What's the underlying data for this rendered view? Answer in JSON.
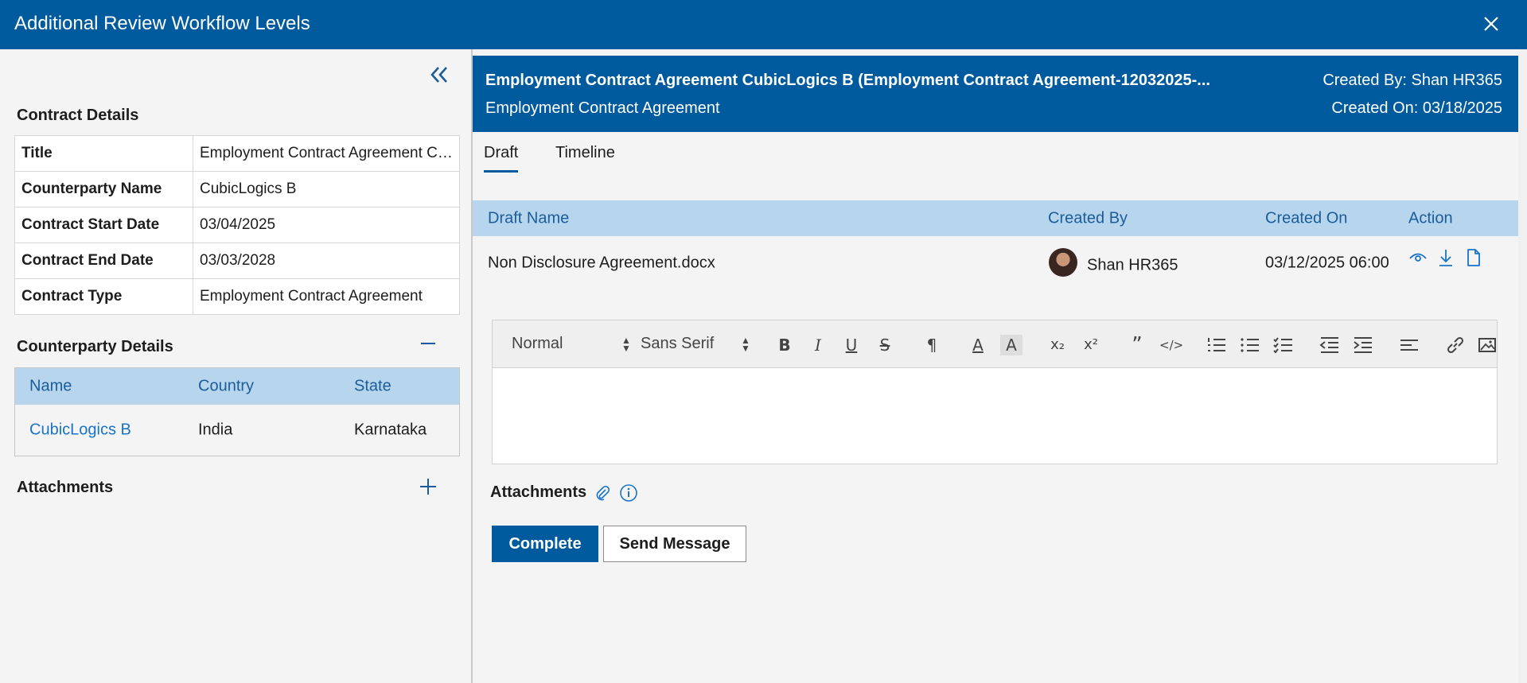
{
  "window": {
    "title": "Additional Review Workflow Levels"
  },
  "left": {
    "contract_details_title": "Contract Details",
    "details": [
      {
        "key": "Title",
        "value": "Employment Contract Agreement CubicLogics B"
      },
      {
        "key": "Counterparty Name",
        "value": "CubicLogics B"
      },
      {
        "key": "Contract Start Date",
        "value": "03/04/2025"
      },
      {
        "key": "Contract End Date",
        "value": "03/03/2028"
      },
      {
        "key": "Contract Type",
        "value": "Employment Contract Agreement"
      }
    ],
    "counterparty_title": "Counterparty Details",
    "counterparty_columns": [
      "Name",
      "Country",
      "State"
    ],
    "counterparty_rows": [
      {
        "name": "CubicLogics B",
        "country": "India",
        "state": "Karnataka"
      }
    ],
    "attachments_title": "Attachments"
  },
  "header": {
    "title": "Employment Contract Agreement CubicLogics B (Employment Contract Agreement-12032025-...",
    "subtitle": "Employment Contract Agreement",
    "created_by": "Created By: Shan HR365",
    "created_on": "Created On: 03/18/2025"
  },
  "tabs": [
    {
      "label": "Draft",
      "active": true
    },
    {
      "label": "Timeline",
      "active": false
    }
  ],
  "drafts": {
    "columns": [
      "Draft Name",
      "Created By",
      "Created On",
      "Action"
    ],
    "rows": [
      {
        "name": "Non Disclosure Agreement.docx",
        "created_by": "Shan HR365",
        "created_on": "03/12/2025 06:00"
      }
    ]
  },
  "editor": {
    "format_select": "Normal",
    "font_select": "Sans Serif",
    "content": ""
  },
  "attachments_label": "Attachments",
  "buttons": {
    "complete": "Complete",
    "send_message": "Send Message"
  },
  "colors": {
    "primary": "#005a9e",
    "header_row": "#b8d5ee",
    "link": "#1a73c8"
  }
}
